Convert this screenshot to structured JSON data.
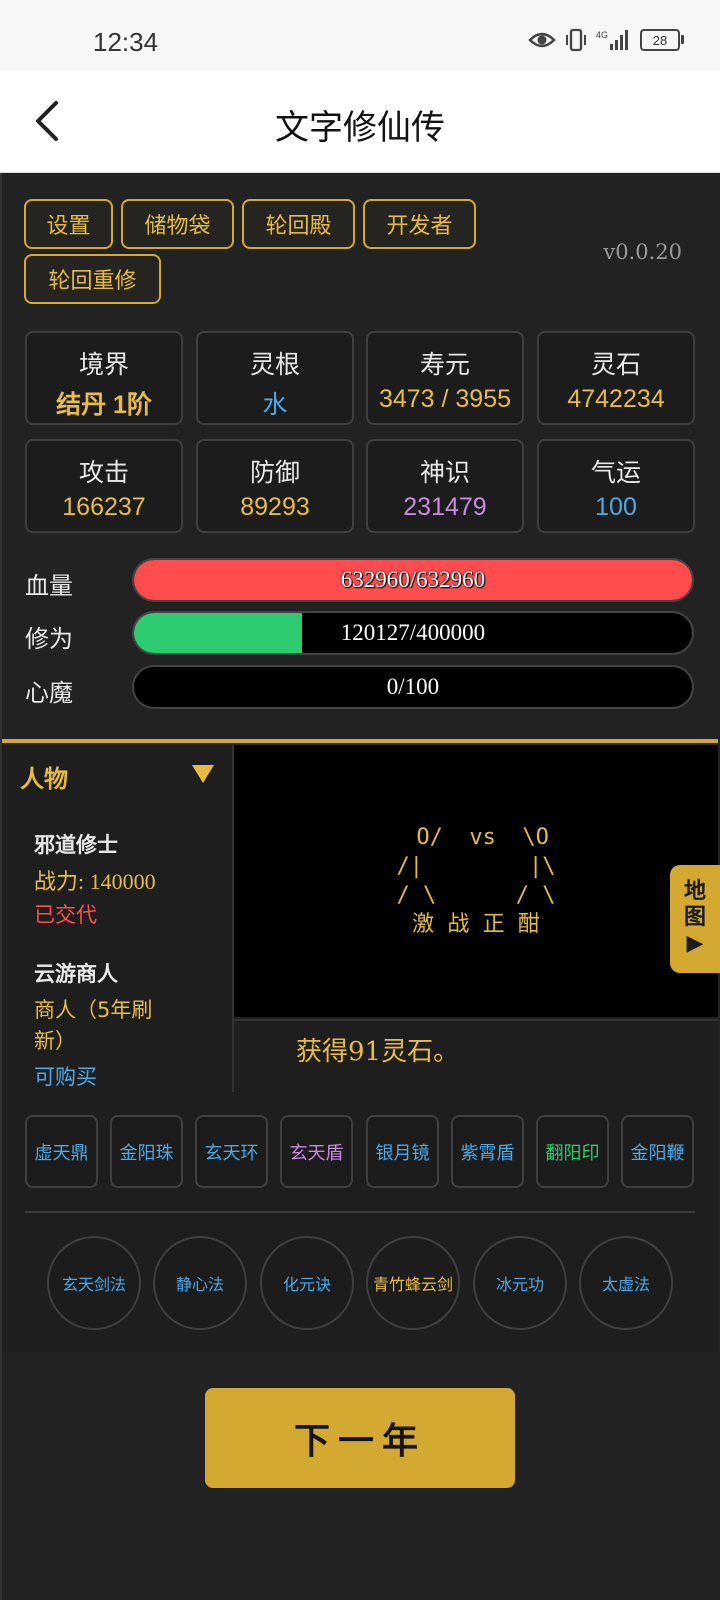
{
  "status_bar": {
    "time": "12:34",
    "battery": "28"
  },
  "header": {
    "title": "文字修仙传"
  },
  "menu": {
    "settings": "设置",
    "storage_bag": "储物袋",
    "reincarnation_hall": "轮回殿",
    "developer": "开发者",
    "reincarnate": "轮回重修"
  },
  "version": "v0.0.20",
  "stats": [
    {
      "label": "境界",
      "value": "结丹 1阶"
    },
    {
      "label": "灵根",
      "value": "水"
    },
    {
      "label": "寿元",
      "value": "3473 / 3955"
    },
    {
      "label": "灵石",
      "value": "4742234"
    },
    {
      "label": "攻击",
      "value": "166237"
    },
    {
      "label": "防御",
      "value": "89293"
    },
    {
      "label": "神识",
      "value": "231479"
    },
    {
      "label": "气运",
      "value": "100"
    }
  ],
  "bars": [
    {
      "label": "血量",
      "text": "632960/632960",
      "fill": 1.0,
      "color": "#ff4d4f"
    },
    {
      "label": "修为",
      "text": "120127/400000",
      "fill": 0.3003,
      "color": "#2ecc71"
    },
    {
      "label": "心魔",
      "text": "0/100",
      "fill": 0.0,
      "color": "#8b5cf6"
    }
  ],
  "left_panel": {
    "header": "人物",
    "npcs": [
      {
        "name": "邪道修士",
        "line1": "战力: 140000",
        "line2": "已交代"
      },
      {
        "name": "云游商人",
        "line1": "商人（5年刷",
        "line2": "新）",
        "line3": "可购买"
      }
    ]
  },
  "battle": {
    "art": " O/  vs  \\O\n/|        |\\\n/ \\      / \\\n激 战 正 酣",
    "map_label": "地图▶"
  },
  "log": {
    "text": "获得91灵石。"
  },
  "items": [
    {
      "label": "虚天鼎",
      "color": "#4ca8e6"
    },
    {
      "label": "金阳珠",
      "color": "#4ca8e6"
    },
    {
      "label": "玄天环",
      "color": "#4ca8e6"
    },
    {
      "label": "玄天盾",
      "color": "#c98be0"
    },
    {
      "label": "银月镜",
      "color": "#4ca8e6"
    },
    {
      "label": "紫霄盾",
      "color": "#4ca8e6"
    },
    {
      "label": "翻阳印",
      "color": "#2ecc71"
    },
    {
      "label": "金阳鞭",
      "color": "#4ca8e6"
    }
  ],
  "skills": [
    {
      "label": "玄天剑法",
      "color": "#4ca8e6"
    },
    {
      "label": "静心法",
      "color": "#4ca8e6"
    },
    {
      "label": "化元诀",
      "color": "#4ca8e6"
    },
    {
      "label": "青竹蜂云剑",
      "color": "#e8bc4a"
    },
    {
      "label": "冰元功",
      "color": "#4ca8e6"
    },
    {
      "label": "太虚法",
      "color": "#4ca8e6"
    }
  ],
  "next_year": "下一年"
}
